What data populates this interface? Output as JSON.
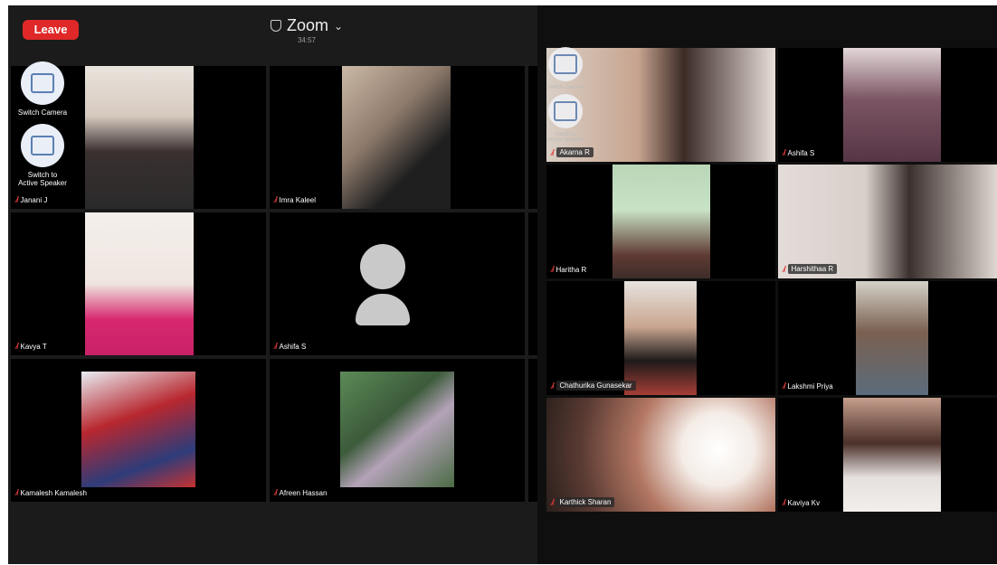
{
  "left": {
    "leave_label": "Leave",
    "title": "Zoom",
    "timer": "34:57",
    "controls": {
      "switch_camera": "Switch Camera",
      "switch_speaker_line1": "Switch to",
      "switch_speaker_line2": "Active Speaker"
    },
    "participants": [
      {
        "name": "Janani J"
      },
      {
        "name": "Imra Kaleel"
      },
      {
        "name": "Kavya T"
      },
      {
        "name": "Ashifa S"
      },
      {
        "name": "Kamalesh Kamalesh"
      },
      {
        "name": "Afreen Hassan"
      }
    ]
  },
  "right": {
    "controls": {
      "switch_camera": "Switch Camera",
      "switch_speaker_line1": "Switch to",
      "switch_speaker_line2": "Active Speaker"
    },
    "participants": [
      {
        "name": "Akarna R"
      },
      {
        "name": "Ashifa S"
      },
      {
        "name": "Haritha R"
      },
      {
        "name": "Harshithaa R"
      },
      {
        "name": "Chathurika Gunasekar"
      },
      {
        "name": "Lakshmi Priya"
      },
      {
        "name": "Karthick Sharan"
      },
      {
        "name": "Kaviya Kv"
      }
    ]
  },
  "colors": {
    "leave_red": "#e02828",
    "muted_mic": "#e23a3a",
    "background": "#1b1b1b"
  }
}
